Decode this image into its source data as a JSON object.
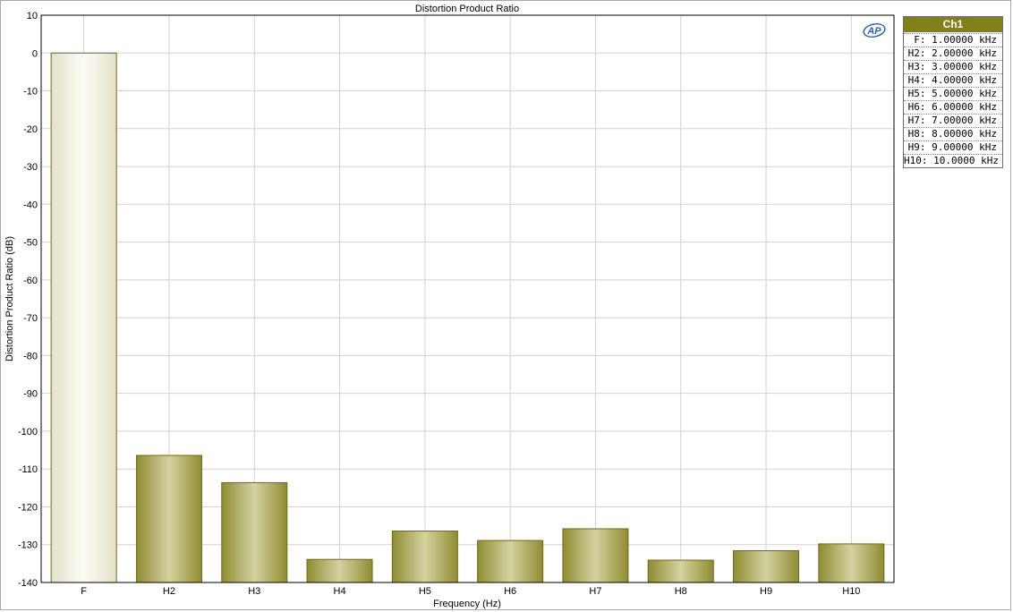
{
  "chart_data": {
    "type": "bar",
    "title": "Distortion Product Ratio",
    "xlabel": "Frequency (Hz)",
    "ylabel": "Distortion Product Ratio (dB)",
    "ylim": [
      -140,
      10
    ],
    "yticks": [
      "10",
      "0",
      "-10",
      "-20",
      "-30",
      "-40",
      "-50",
      "-60",
      "-70",
      "-80",
      "-90",
      "-100",
      "-110",
      "-120",
      "-130",
      "-140"
    ],
    "categories": [
      "F",
      "H2",
      "H3",
      "H4",
      "H5",
      "H6",
      "H7",
      "H8",
      "H9",
      "H10"
    ],
    "series": [
      {
        "name": "Ch1",
        "values": [
          0,
          -106.4,
          -113.6,
          -133.9,
          -126.4,
          -128.9,
          -125.8,
          -134.1,
          -131.6,
          -129.8
        ]
      }
    ],
    "grid": true,
    "legend_position": "right"
  },
  "legend": {
    "header": "Ch1",
    "items": [
      "F: 1.00000 kHz",
      "H2: 2.00000 kHz",
      "H3: 3.00000 kHz",
      "H4: 4.00000 kHz",
      "H5: 5.00000 kHz",
      "H6: 6.00000 kHz",
      "H7: 7.00000 kHz",
      "H8: 8.00000 kHz",
      "H9: 9.00000 kHz",
      "H10: 10.0000 kHz"
    ]
  },
  "colors": {
    "bar_fill": "#b0ad58",
    "bar_edge": "#6d6a14",
    "fundamental_fill": "#f2f1e4",
    "legend_header": "#83801a",
    "grid": "#d2d2d2",
    "logo": "#2a5fae"
  },
  "logo": {
    "text": "AP",
    "icon": "ap-logo-icon"
  }
}
